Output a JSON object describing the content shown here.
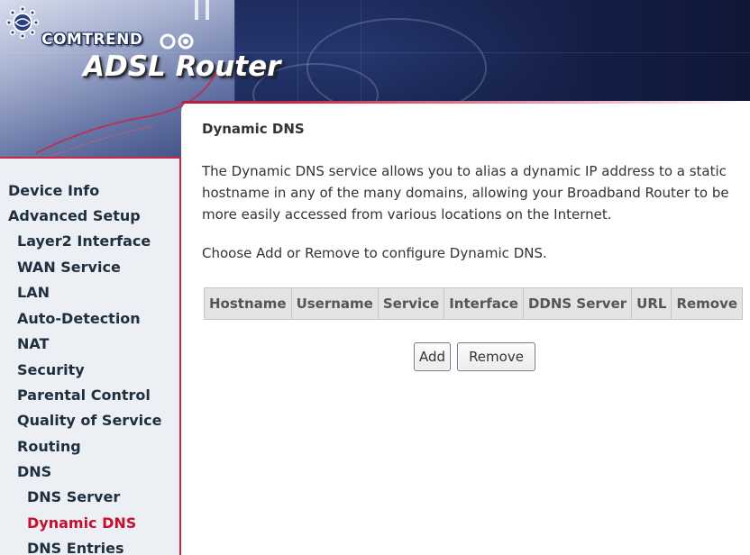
{
  "header": {
    "brand": "COMTREND",
    "product": "ADSL Router",
    "logo_icon": "globe-swirl-icon"
  },
  "sidebar": {
    "items": [
      {
        "label": "Device Info",
        "level": 1
      },
      {
        "label": "Advanced Setup",
        "level": 1
      },
      {
        "label": "Layer2 Interface",
        "level": 2
      },
      {
        "label": "WAN Service",
        "level": 2
      },
      {
        "label": "LAN",
        "level": 2
      },
      {
        "label": "Auto-Detection",
        "level": 2
      },
      {
        "label": "NAT",
        "level": 2
      },
      {
        "label": "Security",
        "level": 2
      },
      {
        "label": "Parental Control",
        "level": 2
      },
      {
        "label": "Quality of Service",
        "level": 2
      },
      {
        "label": "Routing",
        "level": 2
      },
      {
        "label": "DNS",
        "level": 2
      },
      {
        "label": "DNS Server",
        "level": 3
      },
      {
        "label": "Dynamic DNS",
        "level": 3,
        "active": true
      },
      {
        "label": "DNS Entries",
        "level": 3
      }
    ]
  },
  "main": {
    "title": "Dynamic DNS",
    "description": "The Dynamic DNS service allows you to alias a dynamic IP address to a static hostname in any of the many domains, allowing your Broadband Router to be more easily accessed from various locations on the Internet.",
    "hint": "Choose Add or Remove to configure Dynamic DNS.",
    "table": {
      "columns": [
        "Hostname",
        "Username",
        "Service",
        "Interface",
        "DDNS Server",
        "URL",
        "Remove"
      ]
    },
    "buttons": {
      "add_label": "Add",
      "remove_label": "Remove"
    }
  },
  "colors": {
    "accent_red": "#c8264a",
    "active_link": "#c8102e",
    "sidebar_bg": "#eceff3",
    "banner_navy": "#1e2c5e"
  }
}
